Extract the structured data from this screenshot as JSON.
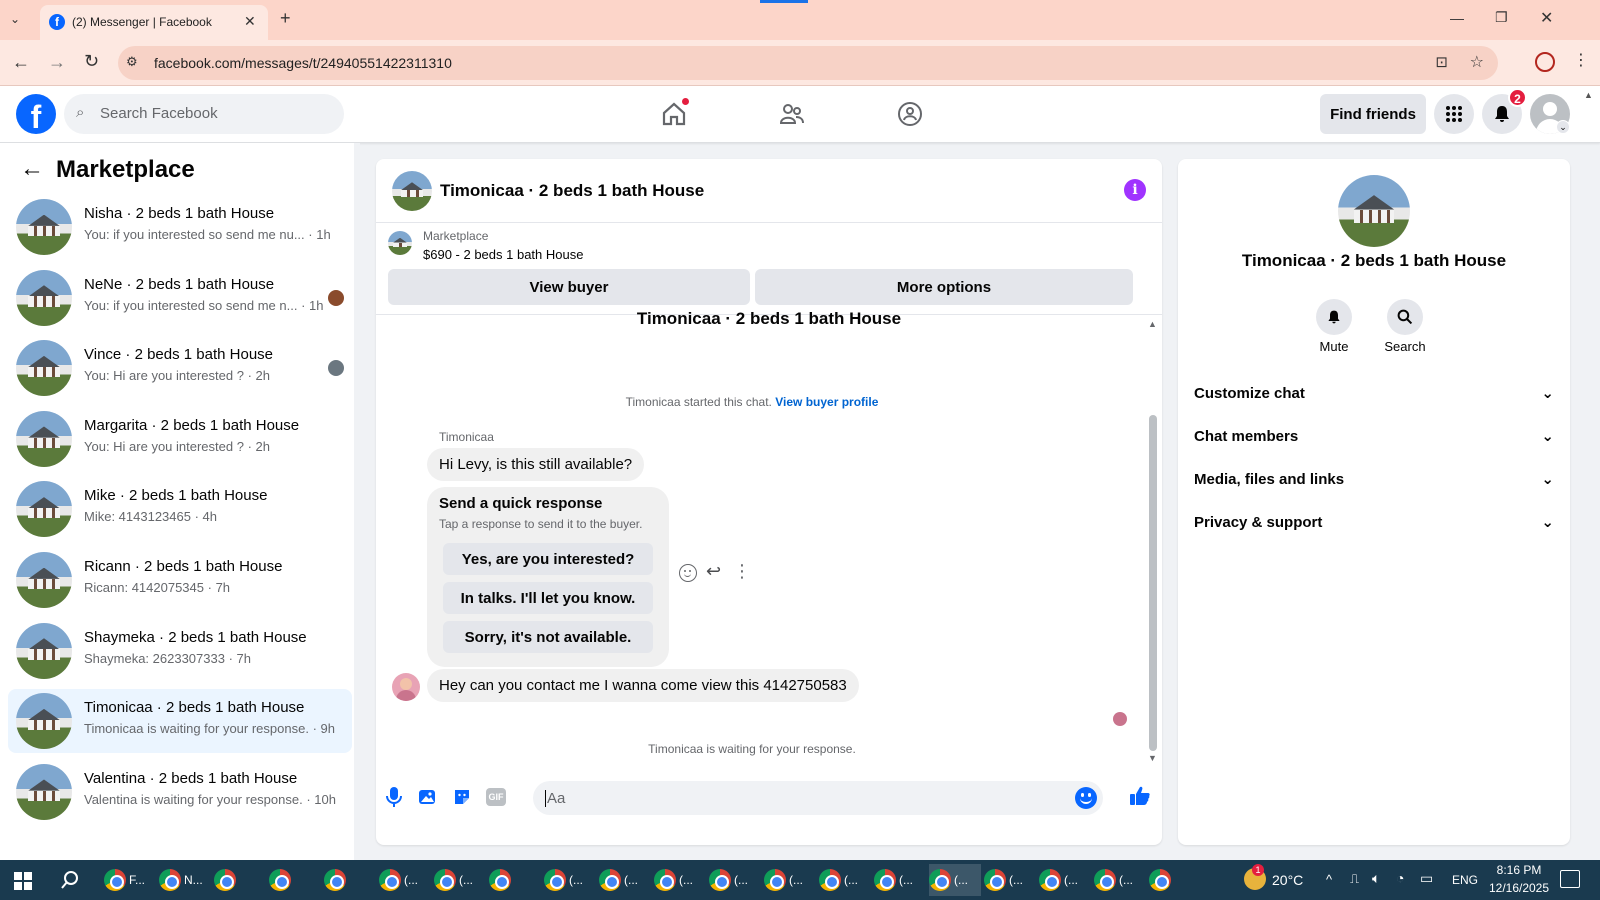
{
  "browser": {
    "tab_title": "(2) Messenger | Facebook",
    "url": "facebook.com/messages/t/24940551422311310"
  },
  "header": {
    "search_placeholder": "Search Facebook",
    "find_friends": "Find friends",
    "notification_count": "2"
  },
  "sidebar": {
    "title": "Marketplace",
    "conversations": [
      {
        "title": "Nisha · 2 beds 1 bath House",
        "sub": "You: if you interested so send me nu...",
        "time": "· 1h",
        "active": false
      },
      {
        "title": "NeNe · 2 beds 1 bath House",
        "sub": "You: if you interested so send me n...",
        "time": "· 1h",
        "active": false
      },
      {
        "title": "Vince · 2 beds 1 bath House",
        "sub": "You: Hi are you interested ?",
        "time": "· 2h",
        "active": false
      },
      {
        "title": "Margarita · 2 beds 1 bath House",
        "sub": "You: Hi are you interested ?",
        "time": "· 2h",
        "active": false
      },
      {
        "title": "Mike · 2 beds 1 bath House",
        "sub": "Mike: 4143123465",
        "time": "· 4h",
        "active": false
      },
      {
        "title": "Ricann · 2 beds 1 bath House",
        "sub": "Ricann: 4142075345",
        "time": "· 7h",
        "active": false
      },
      {
        "title": "Shaymeka · 2 beds 1 bath House",
        "sub": "Shaymeka: 2623307333",
        "time": "· 7h",
        "active": false
      },
      {
        "title": "Timonicaa · 2 beds 1 bath House",
        "sub": "Timonicaa is waiting for your response.",
        "time": "· 9h",
        "active": true
      },
      {
        "title": "Valentina · 2 beds 1 bath House",
        "sub": "Valentina is waiting for your response.",
        "time": "· 10h",
        "active": false
      }
    ]
  },
  "chat": {
    "title": "Timonicaa · 2 beds 1 bath House",
    "listing_label": "Marketplace",
    "listing_detail": "$690 - 2 beds 1 bath House",
    "view_buyer": "View buyer",
    "more_options": "More options",
    "thread_title": "Timonicaa · 2 beds 1 bath House",
    "started_text": "Timonicaa started this chat.",
    "view_buyer_profile": "View buyer profile",
    "sender_name": "Timonicaa",
    "msg1": "Hi Levy, is this still available?",
    "quick_title": "Send a quick response",
    "quick_sub": "Tap a response to send it to the buyer.",
    "quick_responses": [
      "Yes, are you interested?",
      "In talks. I'll let you know.",
      "Sorry, it's not available."
    ],
    "msg2": "Hey can you contact me I wanna come view this 4142750583",
    "waiting": "Timonicaa is waiting for your response.",
    "composer_placeholder": "Aa"
  },
  "info": {
    "name": "Timonicaa · 2 beds 1 bath House",
    "mute": "Mute",
    "search": "Search",
    "rows": [
      "Customize chat",
      "Chat members",
      "Media, files and links",
      "Privacy & support"
    ]
  },
  "taskbar": {
    "weather": "20°C",
    "lang": "ENG",
    "time": "8:16 PM",
    "date": "12/16/2025",
    "weather_badge": "1",
    "app_labels": [
      "F...",
      "N...",
      "",
      "",
      "",
      "(...",
      "(...",
      "",
      "(...",
      "(...",
      "(...",
      "(...",
      "(...",
      "(...",
      "(...",
      "(...",
      "(...",
      "(...",
      "(...",
      ""
    ]
  },
  "colors": {
    "fb_blue": "#0866ff",
    "messenger_purple": "#a033ff",
    "active_conv": "#ebf5ff",
    "badge_red": "#e41e3f"
  }
}
